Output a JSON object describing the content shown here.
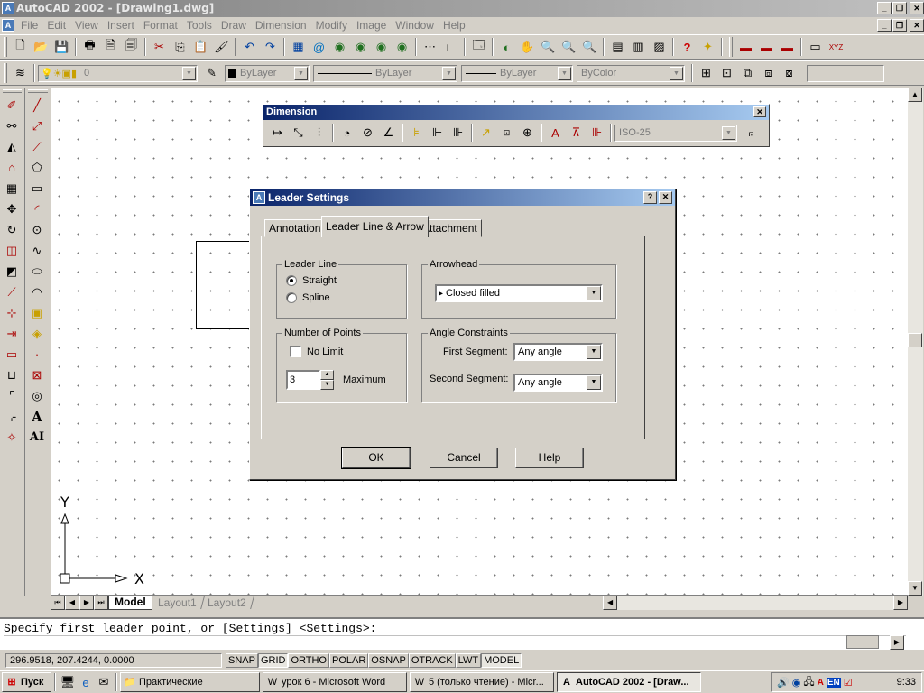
{
  "app": {
    "title": "AutoCAD 2002 - [Drawing1.dwg]",
    "icon": "autocad-icon",
    "window_buttons": [
      "_",
      "❐",
      "✕"
    ]
  },
  "menu": [
    "File",
    "Edit",
    "View",
    "Insert",
    "Format",
    "Tools",
    "Draw",
    "Dimension",
    "Modify",
    "Image",
    "Window",
    "Help"
  ],
  "properties": {
    "layer": "0",
    "color": "ByLayer",
    "linetype": "ByLayer",
    "lineweight": "ByLayer",
    "plotstyle": "ByColor"
  },
  "dimension_toolbar": {
    "title": "Dimension",
    "style_value": "ISO-25"
  },
  "dialog": {
    "title": "Leader Settings",
    "help_btn": "?",
    "close_btn": "✕",
    "tabs": [
      "Annotation",
      "Leader Line & Arrow",
      "Attachment"
    ],
    "active_tab": "Leader Line & Arrow",
    "leader_line": {
      "label": "Leader Line",
      "options": [
        "Straight",
        "Spline"
      ],
      "selected": "Straight"
    },
    "arrowhead": {
      "label": "Arrowhead",
      "value": "Closed filled"
    },
    "points": {
      "label": "Number of Points",
      "no_limit": "No Limit",
      "no_limit_checked": false,
      "value": "3",
      "maximum": "Maximum"
    },
    "angles": {
      "label": "Angle Constraints",
      "first_label": "First Segment:",
      "first_value": "Any angle",
      "second_label": "Second Segment:",
      "second_value": "Any angle"
    },
    "buttons": {
      "ok": "OK",
      "cancel": "Cancel",
      "help": "Help"
    }
  },
  "ucs": {
    "x": "X",
    "y": "Y"
  },
  "layout_tabs": [
    "Model",
    "Layout1",
    "Layout2"
  ],
  "active_layout": "Model",
  "command_line": "Specify first leader point, or [Settings] <Settings>:",
  "status": {
    "coords": "296.9518, 207.4244, 0.0000",
    "modes": [
      "SNAP",
      "GRID",
      "ORTHO",
      "POLAR",
      "OSNAP",
      "OTRACK",
      "LWT",
      "MODEL"
    ],
    "active_modes": [
      "GRID",
      "MODEL"
    ]
  },
  "taskbar": {
    "start": "Пуск",
    "tasks": [
      "Практические",
      "урок 6 - Microsoft Word",
      "5 (только чтение) - Micr...",
      "AutoCAD 2002 - [Draw..."
    ],
    "active_task": "AutoCAD 2002 - [Draw...",
    "tray_lang": "EN",
    "clock": "9:33"
  }
}
